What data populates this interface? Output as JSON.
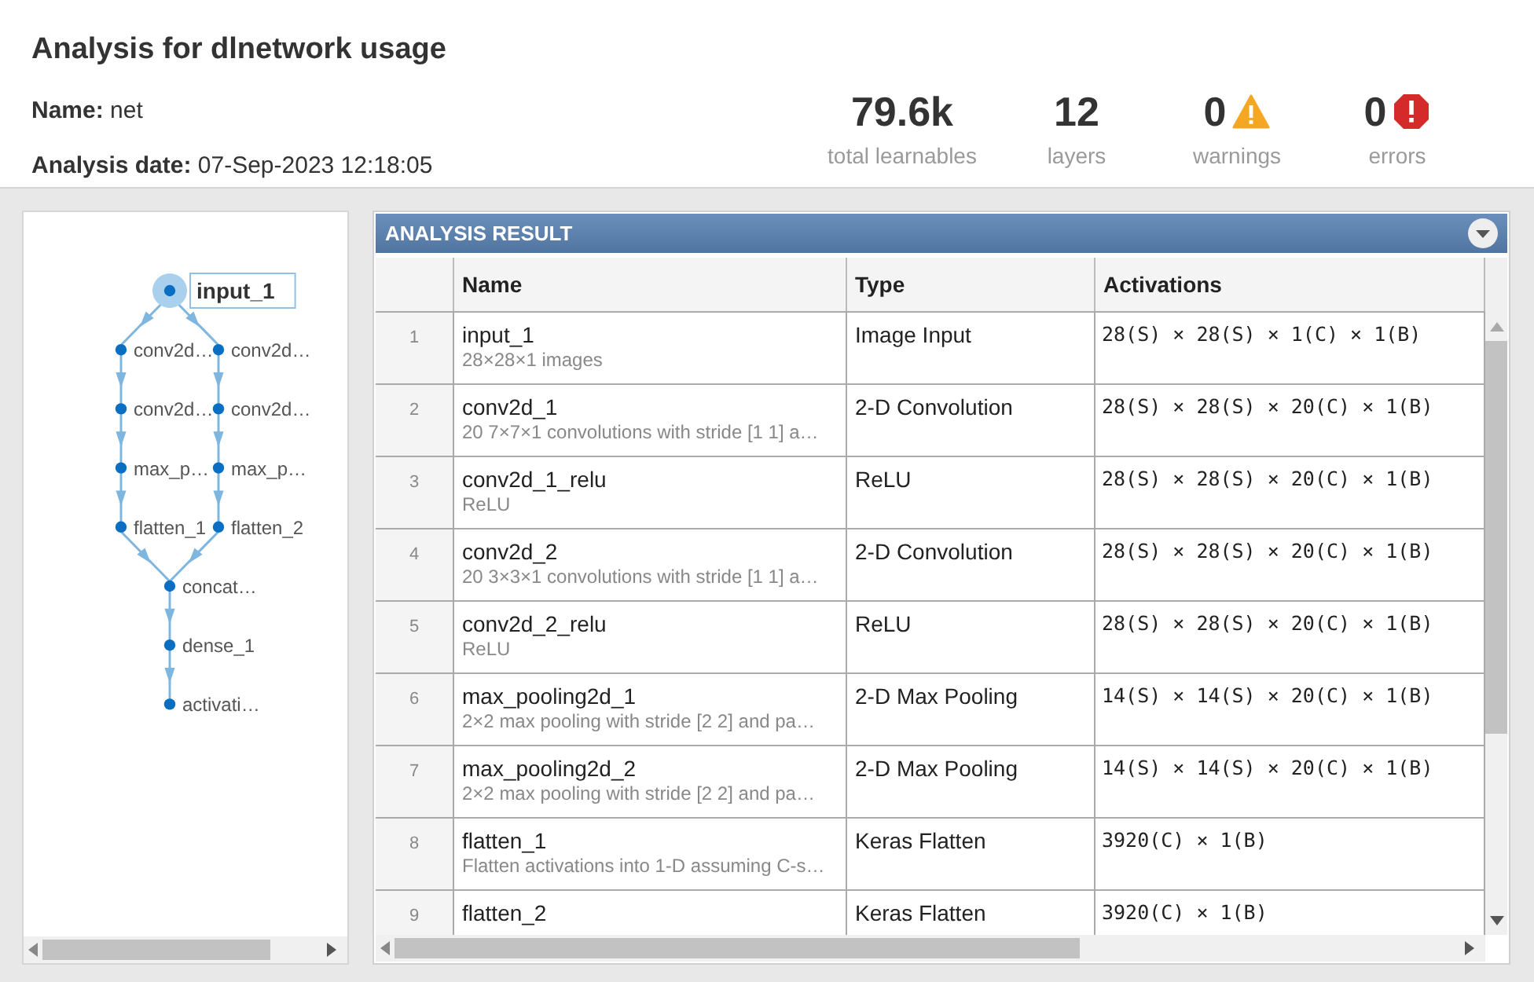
{
  "header": {
    "title": "Analysis for dlnetwork usage",
    "fields": [
      {
        "label": "Name:",
        "value": "net"
      },
      {
        "label": "Analysis date:",
        "value": "07-Sep-2023 12:18:05"
      }
    ],
    "stats": [
      {
        "kind": "plain",
        "value": "79.6k",
        "label": "total learnables"
      },
      {
        "kind": "plain",
        "value": "12",
        "label": "layers"
      },
      {
        "kind": "warning",
        "value": "0",
        "label": "warnings"
      },
      {
        "kind": "error",
        "value": "0",
        "label": "errors"
      }
    ]
  },
  "graph": {
    "input": {
      "label": "input_1",
      "selected": true
    },
    "branches": [
      [
        {
          "label": "conv2d…",
          "selected": false
        },
        {
          "label": "conv2d…",
          "selected": false
        },
        {
          "label": "max_p…",
          "selected": false
        },
        {
          "label": "flatten_1",
          "selected": false
        }
      ],
      [
        {
          "label": "conv2d…",
          "selected": false
        },
        {
          "label": "conv2d…",
          "selected": false
        },
        {
          "label": "max_p…",
          "selected": false
        },
        {
          "label": "flatten_2",
          "selected": false
        }
      ]
    ],
    "tail": [
      {
        "label": "concat…",
        "selected": false
      },
      {
        "label": "dense_1",
        "selected": false
      },
      {
        "label": "activati…",
        "selected": false
      }
    ]
  },
  "result": {
    "title": "ANALYSIS RESULT",
    "columns": [
      "Name",
      "Type",
      "Activations"
    ],
    "rows": [
      {
        "index": "1",
        "name": "input_1",
        "description": "28×28×1 images",
        "type": "Image Input",
        "activations": "28(S) × 28(S) × 1(C) × 1(B)"
      },
      {
        "index": "2",
        "name": "conv2d_1",
        "description": "20 7×7×1 convolutions with stride [1 1] a…",
        "type": "2-D Convolution",
        "activations": "28(S) × 28(S) × 20(C) × 1(B)"
      },
      {
        "index": "3",
        "name": "conv2d_1_relu",
        "description": "ReLU",
        "type": "ReLU",
        "activations": "28(S) × 28(S) × 20(C) × 1(B)"
      },
      {
        "index": "4",
        "name": "conv2d_2",
        "description": "20 3×3×1 convolutions with stride [1 1] a…",
        "type": "2-D Convolution",
        "activations": "28(S) × 28(S) × 20(C) × 1(B)"
      },
      {
        "index": "5",
        "name": "conv2d_2_relu",
        "description": "ReLU",
        "type": "ReLU",
        "activations": "28(S) × 28(S) × 20(C) × 1(B)"
      },
      {
        "index": "6",
        "name": "max_pooling2d_1",
        "description": "2×2 max pooling with stride [2 2] and pa…",
        "type": "2-D Max Pooling",
        "activations": "14(S) × 14(S) × 20(C) × 1(B)"
      },
      {
        "index": "7",
        "name": "max_pooling2d_2",
        "description": "2×2 max pooling with stride [2 2] and pa…",
        "type": "2-D Max Pooling",
        "activations": "14(S) × 14(S) × 20(C) × 1(B)"
      },
      {
        "index": "8",
        "name": "flatten_1",
        "description": "Flatten activations into 1-D assuming C-s…",
        "type": "Keras Flatten",
        "activations": "3920(C) × 1(B)"
      },
      {
        "index": "9",
        "name": "flatten_2",
        "type": "Keras Flatten",
        "activations": "3920(C) × 1(B)"
      }
    ]
  }
}
